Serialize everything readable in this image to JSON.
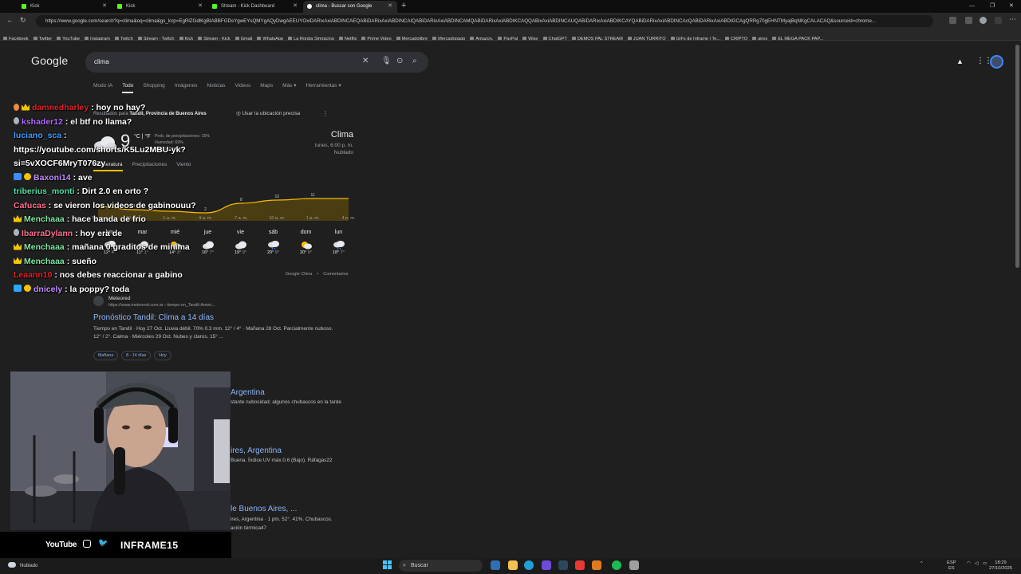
{
  "browser": {
    "tabs": [
      {
        "label": "Kick",
        "favicon": "kick-icon"
      },
      {
        "label": "Kick",
        "favicon": "kick-icon"
      },
      {
        "label": "Stream - Kick Dashboard",
        "favicon": "kick-icon"
      },
      {
        "label": "clima - Buscar con Google",
        "favicon": "google-icon",
        "active": true
      }
    ],
    "url": "https://www.google.com/search?q=clima&oq=clima&gs_lcrp=EgRlZGdlKgBIABBFGDsYgwEYsQMYgAQyDwgAEEUYOxiDARixAxiABDINCAEQABiDARixAxiABDINCAIQABiDARixAxiABDINCAMQABiDARixAxiABDIKCAQQABixAxiABDINCAUQABiDARixAxiABDIKCAYQABiDARixAxiABDINCAcQABiDARixAxiABDIGCAgQRRg70gEHNTMyajBqNKgCALACAQ&sourceid=chrome...",
    "bookmarks": [
      "Facebook",
      "Twitter",
      "YouTube",
      "Instagram",
      "Twitch",
      "Stream - Twitch",
      "Kick",
      "Stream - Kick",
      "Gmail",
      "WhatsApp",
      "La Ronda Simracing",
      "Netflix",
      "Prime Video",
      "Mercadolibre",
      "Mercadopago",
      "Amazon.",
      "PayPal",
      "Wise",
      "ChatGPT",
      "DEMOS PAL STREAM",
      "JUAN TURRITO",
      "GIFs de Inframe | Te...",
      "CRIPTO",
      "aires",
      "EL MEGA PACK PAP..."
    ]
  },
  "google": {
    "logo": "Google",
    "query": "clima",
    "filters": [
      "Modo IA",
      "Todo",
      "Shopping",
      "Imágenes",
      "Noticias",
      "Videos",
      "Maps",
      "Más ▾",
      "Herramientas ▾"
    ],
    "active_filter": "Todo",
    "location_prefix": "Resultados para",
    "location": "Tandil, Provincia de Buenos Aires",
    "location_button": "Usar la ubicación precisa",
    "weather": {
      "temp": "9",
      "units": "°C | °F",
      "precip": "Prob. de precipitaciones: 15%",
      "humidity": "Humedad: 69%",
      "wind": "Viento: 8 km/h",
      "title": "Clima",
      "datetime": "lunes, 6:00 p. m.",
      "condition": "Nublado",
      "tabs": [
        "Temperatura",
        "Precipitaciones",
        "Viento"
      ],
      "footer_link": "Google Clima",
      "footer_feedback": "Comentarios"
    },
    "result1": {
      "site": "Meteored",
      "url": "https://www.meteored.com.ar › tiempo-en_Tandil-Ameri...",
      "title": "Pronóstico Tandil: Clima a 14 días",
      "snippet": "Tiempo en Tandil · Hoy 27 Oct. Lluvia débil. 70% 0.3 mm. 12° / 4° · Mañana 28 Oct. Parcialmente nuboso. 12° / 2°. Calma · Miércoles 29 Oct. Nubes y claros. 15° ...",
      "chips": [
        "Mañana",
        "8 - 14 días",
        "Hoy"
      ]
    },
    "partials": [
      {
        "title": "Argentina",
        "snippet": "stante nubosidad; algunos chubascos en la tarde"
      },
      {
        "title": "ires, Argentina",
        "snippet": "Buena. Índice UV máx.0.6 (Bajo). Ráfagas22"
      },
      {
        "title": "le Buenos Aires, ...",
        "snippet": "ires, Argentina · 1 pm. 52°. 41%. Chubascos."
      },
      {
        "title": "",
        "snippet": "ación térmica47"
      }
    ]
  },
  "chart_data": {
    "type": "area",
    "x": [
      "7 p. m.",
      "10 p. m.",
      "1 a. m.",
      "4 a. m.",
      "7 a. m.",
      "10 a. m.",
      "1 p. m.",
      "4 p. m."
    ],
    "values": [
      6,
      4,
      3,
      2,
      8,
      10,
      11,
      11
    ],
    "labels": [
      "",
      "4",
      "3",
      "2",
      "8",
      "10",
      "11",
      ""
    ],
    "series_color": "#fbbc04"
  },
  "forecast": [
    {
      "day": "lun",
      "hi": "12°",
      "lo": "4°",
      "icon": "rain-cloud-icon"
    },
    {
      "day": "mar",
      "hi": "11°",
      "lo": "1°",
      "icon": "cloud-icon"
    },
    {
      "day": "mié",
      "hi": "14°",
      "lo": "3°",
      "icon": "partly-sunny-icon"
    },
    {
      "day": "jue",
      "hi": "16°",
      "lo": "7°",
      "icon": "cloud-icon"
    },
    {
      "day": "vie",
      "hi": "19°",
      "lo": "9°",
      "icon": "cloud-icon"
    },
    {
      "day": "sáb",
      "hi": "20°",
      "lo": "9°",
      "icon": "rain-cloud-icon"
    },
    {
      "day": "dom",
      "hi": "20°",
      "lo": "9°",
      "icon": "partly-sunny-icon"
    },
    {
      "day": "lun",
      "hi": "18°",
      "lo": "7°",
      "icon": "rain-cloud-icon"
    }
  ],
  "chat": [
    {
      "badges": [
        "orange",
        "crown"
      ],
      "user": "damnedharley",
      "color": "#e0202a",
      "text": ": hoy no hay?"
    },
    {
      "badges": [
        "gray"
      ],
      "user": "kshader12",
      "color": "#b266ff",
      "text": ": el btf no llama?"
    },
    {
      "badges": [],
      "user": "luciano_sca",
      "color": "#3f9cff",
      "text": ": https://youtube.com/shorts/K5Lu2MBU-yk?si=5vXOCF6MryT076zy"
    },
    {
      "badges": [
        "blue",
        "one"
      ],
      "user": "Baxoni14",
      "color": "#c08bff",
      "text": ": ave"
    },
    {
      "badges": [],
      "user": "triberius_monti",
      "color": "#4be0a4",
      "text": ": Dirt 2.0 en orto ?"
    },
    {
      "badges": [],
      "user": "Cafucas",
      "color": "#ff6f8f",
      "text": ": se vieron los videos de gabinouuu?"
    },
    {
      "badges": [
        "crown"
      ],
      "user": "Menchaaa",
      "color": "#7ee8a2",
      "text": ": hace banda de frio"
    },
    {
      "badges": [
        "gray"
      ],
      "user": "IbarraDylann",
      "color": "#ff6f8f",
      "text": ": hoy era de"
    },
    {
      "badges": [
        "crown"
      ],
      "user": "Menchaaa",
      "color": "#7ee8a2",
      "text": ": mañana 0 graditos de minima"
    },
    {
      "badges": [
        "crown"
      ],
      "user": "Menchaaa",
      "color": "#7ee8a2",
      "text": ": sueño"
    },
    {
      "badges": [],
      "user": "Leaann10",
      "color": "#e0202a",
      "text": ": nos debes reaccionar a gabino"
    },
    {
      "badges": [
        "cube",
        "one"
      ],
      "user": "dnicely",
      "color": "#c08bff",
      "text": ": la poppy? toda"
    }
  ],
  "overlay": {
    "youtube": "YouTube",
    "channel": "INFRAME15"
  },
  "status": {
    "weather_text": "Nublado",
    "taskbar_search": "Buscar",
    "lang": "ESP",
    "lang_sub": "ES",
    "time": "18:29",
    "date": "27/10/2025"
  }
}
